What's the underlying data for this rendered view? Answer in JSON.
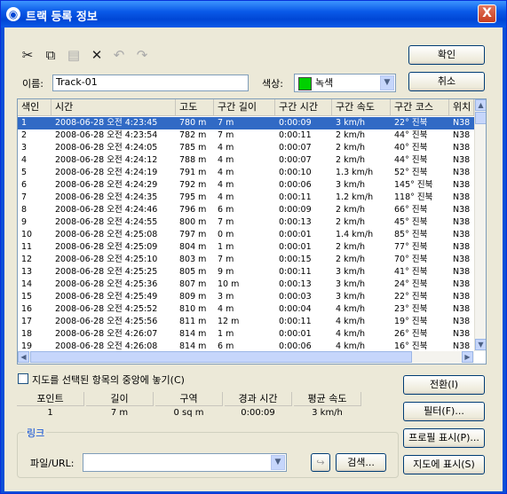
{
  "window": {
    "title": "트랙 등록 정보",
    "close": "X"
  },
  "toolbar": {
    "cut": "✂",
    "copy": "⧉",
    "paste": "▤",
    "delete": "✕",
    "undo": "↶",
    "redo": "↷"
  },
  "form": {
    "name_label": "이름:",
    "name_value": "Track-01",
    "color_label": "색상:",
    "color_value": "녹색",
    "color_swatch": "#00d000"
  },
  "buttons": {
    "ok": "확인",
    "cancel": "취소",
    "invert": "전환(I)",
    "filter": "필터(F)...",
    "profile": "프로필 표시(P)...",
    "show_on_map": "지도에 표시(S)",
    "search": "검색..."
  },
  "grid": {
    "columns": [
      "색인",
      "시간",
      "고도",
      "구간 길이",
      "구간 시간",
      "구간 속도",
      "구간 코스",
      "위치"
    ],
    "rows": [
      [
        "1",
        "2008-06-28 오전 4:23:45",
        "780 m",
        "7 m",
        "0:00:09",
        "3 km/h",
        "22° 진북",
        "N38"
      ],
      [
        "2",
        "2008-06-28 오전 4:23:54",
        "782 m",
        "7 m",
        "0:00:11",
        "2 km/h",
        "44° 진북",
        "N38"
      ],
      [
        "3",
        "2008-06-28 오전 4:24:05",
        "785 m",
        "4 m",
        "0:00:07",
        "2 km/h",
        "40° 진북",
        "N38"
      ],
      [
        "4",
        "2008-06-28 오전 4:24:12",
        "788 m",
        "4 m",
        "0:00:07",
        "2 km/h",
        "44° 진북",
        "N38"
      ],
      [
        "5",
        "2008-06-28 오전 4:24:19",
        "791 m",
        "4 m",
        "0:00:10",
        "1.3 km/h",
        "52° 진북",
        "N38"
      ],
      [
        "6",
        "2008-06-28 오전 4:24:29",
        "792 m",
        "4 m",
        "0:00:06",
        "3 km/h",
        "145° 진북",
        "N38"
      ],
      [
        "7",
        "2008-06-28 오전 4:24:35",
        "795 m",
        "4 m",
        "0:00:11",
        "1.2 km/h",
        "118° 진북",
        "N38"
      ],
      [
        "8",
        "2008-06-28 오전 4:24:46",
        "796 m",
        "6 m",
        "0:00:09",
        "2 km/h",
        "66° 진북",
        "N38"
      ],
      [
        "9",
        "2008-06-28 오전 4:24:55",
        "800 m",
        "7 m",
        "0:00:13",
        "2 km/h",
        "45° 진북",
        "N38"
      ],
      [
        "10",
        "2008-06-28 오전 4:25:08",
        "797 m",
        "0 m",
        "0:00:01",
        "1.4 km/h",
        "85° 진북",
        "N38"
      ],
      [
        "11",
        "2008-06-28 오전 4:25:09",
        "804 m",
        "1 m",
        "0:00:01",
        "2 km/h",
        "77° 진북",
        "N38"
      ],
      [
        "12",
        "2008-06-28 오전 4:25:10",
        "803 m",
        "7 m",
        "0:00:15",
        "2 km/h",
        "70° 진북",
        "N38"
      ],
      [
        "13",
        "2008-06-28 오전 4:25:25",
        "805 m",
        "9 m",
        "0:00:11",
        "3 km/h",
        "41° 진북",
        "N38"
      ],
      [
        "14",
        "2008-06-28 오전 4:25:36",
        "807 m",
        "10 m",
        "0:00:13",
        "3 km/h",
        "24° 진북",
        "N38"
      ],
      [
        "15",
        "2008-06-28 오전 4:25:49",
        "809 m",
        "3 m",
        "0:00:03",
        "3 km/h",
        "22° 진북",
        "N38"
      ],
      [
        "16",
        "2008-06-28 오전 4:25:52",
        "810 m",
        "4 m",
        "0:00:04",
        "4 km/h",
        "23° 진북",
        "N38"
      ],
      [
        "17",
        "2008-06-28 오전 4:25:56",
        "811 m",
        "12 m",
        "0:00:11",
        "4 km/h",
        "19° 진북",
        "N38"
      ],
      [
        "18",
        "2008-06-28 오전 4:26:07",
        "814 m",
        "1 m",
        "0:00:01",
        "4 km/h",
        "26° 진북",
        "N38"
      ],
      [
        "19",
        "2008-06-28 오전 4:26:08",
        "814 m",
        "6 m",
        "0:00:06",
        "4 km/h",
        "16° 진북",
        "N38"
      ]
    ]
  },
  "center_checkbox": {
    "label": "지도를 선택된 항목의 중앙에 놓기(C)",
    "checked": false
  },
  "stats": {
    "headers": [
      "포인트",
      "길이",
      "구역",
      "경과 시간",
      "평균 속도"
    ],
    "values": [
      "1",
      "7 m",
      "0 sq m",
      "0:00:09",
      "3 km/h"
    ]
  },
  "link": {
    "group_label": "링크",
    "file_label": "파일/URL:",
    "file_value": ""
  }
}
